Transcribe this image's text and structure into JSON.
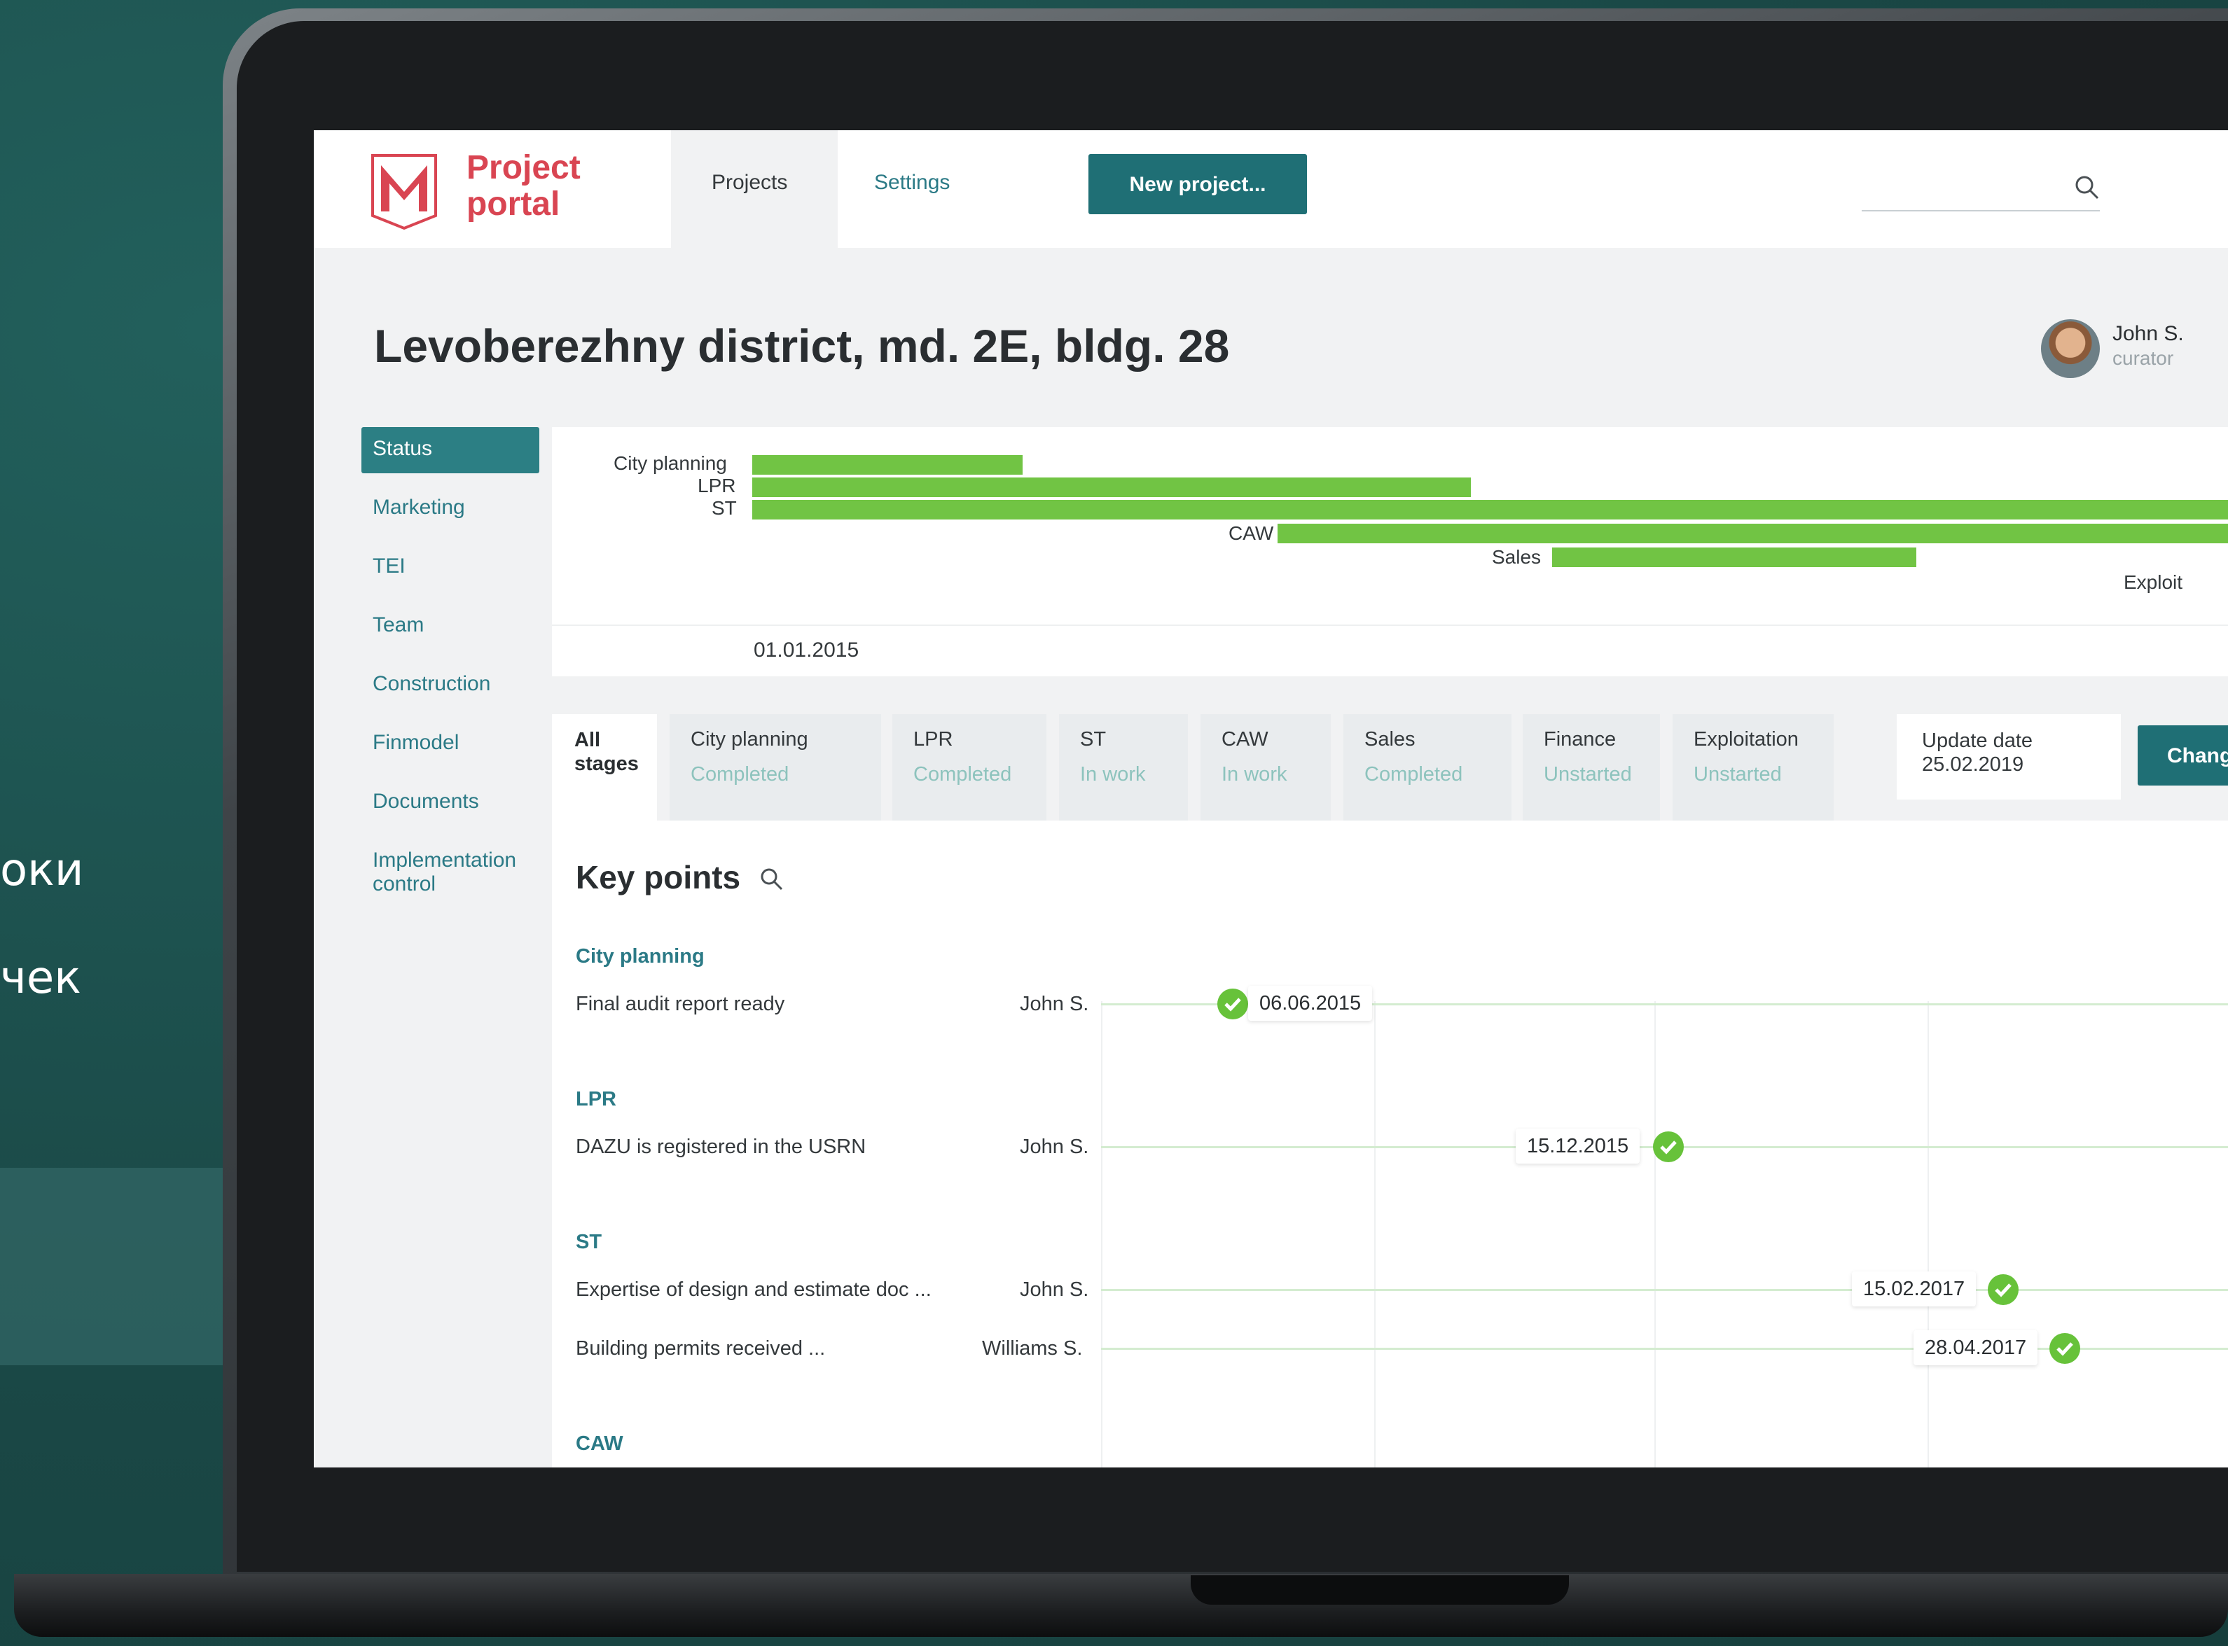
{
  "background_text": {
    "line1": "оки",
    "line2": "чек"
  },
  "header": {
    "logo_line1": "Project",
    "logo_line2": "portal",
    "tab_projects": "Projects",
    "tab_settings": "Settings",
    "new_project_label": "New project..."
  },
  "page": {
    "title": "Levoberezhny district, md. 2E, bldg. 28",
    "user_name": "John S.",
    "user_role": "curator"
  },
  "sidebar": {
    "items": [
      "Status",
      "Marketing",
      "TEI",
      "Team",
      "Construction",
      "Finmodel",
      "Documents",
      "Implementation",
      "control"
    ]
  },
  "gantt": {
    "labels": [
      "City planning",
      "LPR",
      "ST",
      "CAW",
      "Sales",
      "Exploit"
    ],
    "start_date": "01.01.2015",
    "bar_color": "#71c444"
  },
  "stages": {
    "all_label_1": "All",
    "all_label_2": "stages",
    "items": [
      {
        "name": "City planning",
        "status": "Completed"
      },
      {
        "name": "LPR",
        "status": "Completed"
      },
      {
        "name": "ST",
        "status": "In work"
      },
      {
        "name": "CAW",
        "status": "In work"
      },
      {
        "name": "Sales",
        "status": "Completed"
      },
      {
        "name": "Finance",
        "status": "Unstarted"
      },
      {
        "name": "Exploitation",
        "status": "Unstarted"
      }
    ],
    "update_label": "Update date",
    "update_value": "25.02.2019",
    "change_label": "Chang"
  },
  "key_points": {
    "title": "Key points",
    "sections": [
      {
        "name": "City planning",
        "rows": [
          {
            "task": "Final audit report ready",
            "person": "John S.",
            "date": "06.06.2015"
          }
        ]
      },
      {
        "name": "LPR",
        "rows": [
          {
            "task": "DAZU is registered in the USRN",
            "person": "John S.",
            "date": "15.12.2015"
          }
        ]
      },
      {
        "name": "ST",
        "rows": [
          {
            "task": "Expertise of design and estimate doc ...",
            "person": "John S.",
            "date": "15.02.2017"
          },
          {
            "task": "Building permits received ...",
            "person": "Williams S.",
            "date": "28.04.2017"
          }
        ]
      },
      {
        "name": "CAW",
        "rows": []
      }
    ]
  },
  "colors": {
    "accent": "#1f6f75",
    "brand": "#d94552",
    "success": "#67c23a"
  }
}
